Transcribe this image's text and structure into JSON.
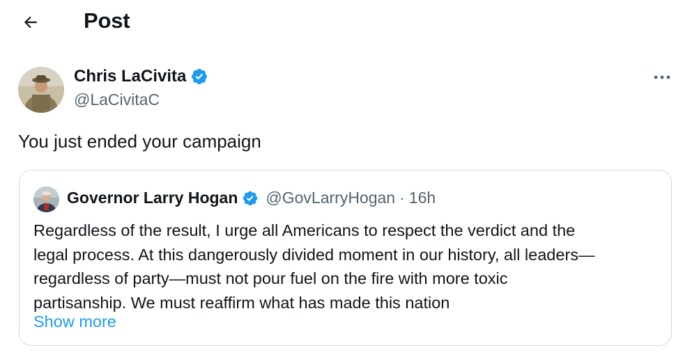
{
  "header": {
    "back_icon": "arrow-left-icon",
    "title": "Post"
  },
  "author": {
    "name": "Chris LaCivita",
    "handle": "@LaCivitaC",
    "verified": true,
    "more_icon": "more-horizontal-icon"
  },
  "tweet": {
    "text": "You just ended your campaign"
  },
  "quote": {
    "name": "Governor Larry Hogan",
    "handle": "@GovLarryHogan",
    "separator": "·",
    "time": "16h",
    "verified": true,
    "lines": [
      "Regardless of the result, I urge all Americans to respect the verdict and the",
      "legal process. At this dangerously divided moment in our history, all leaders—",
      "regardless of party—must not pour fuel on the fire with more toxic",
      "partisanship. We must reaffirm what has made this nation"
    ],
    "show_more": "Show more"
  },
  "colors": {
    "text": "#0f1419",
    "secondary": "#536471",
    "link": "#1d9bf0",
    "verified": "#1d9bf0",
    "border": "#cfd9de"
  }
}
